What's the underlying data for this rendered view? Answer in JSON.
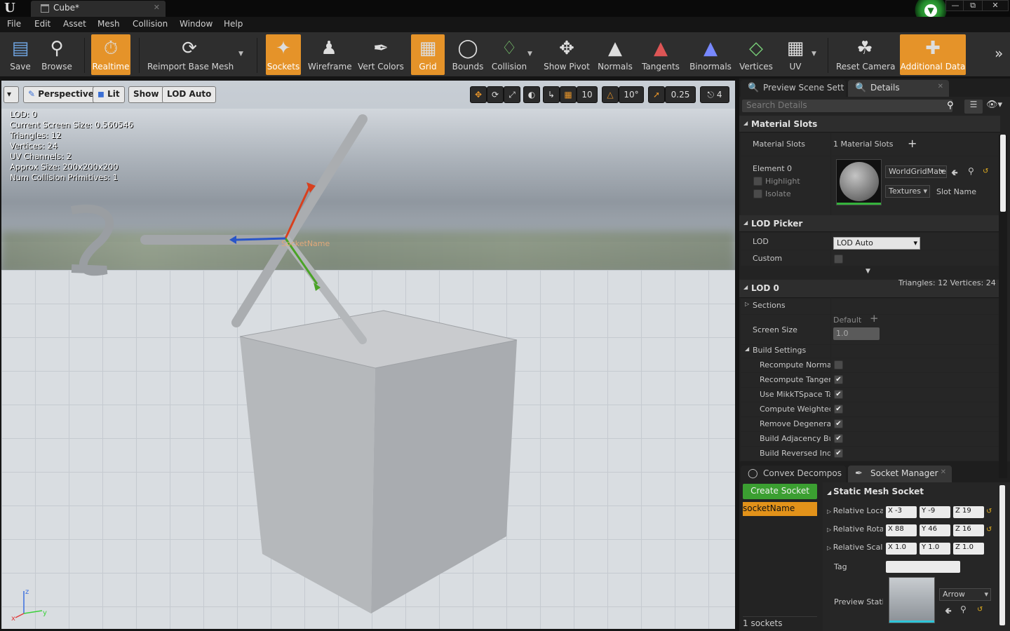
{
  "window": {
    "tab_title": "Cube*",
    "close_glyph": "✕",
    "minimize_glyph": "—",
    "restore_glyph": "⧉",
    "close_btn_glyph": "✕",
    "badge_glyph": "▼"
  },
  "menu": [
    "File",
    "Edit",
    "Asset",
    "Mesh",
    "Collision",
    "Window",
    "Help"
  ],
  "toolbar": {
    "save": "Save",
    "browse": "Browse",
    "realtime": "Realtime",
    "reimport": "Reimport Base Mesh",
    "sockets": "Sockets",
    "wireframe": "Wireframe",
    "vert_colors": "Vert Colors",
    "grid": "Grid",
    "bounds": "Bounds",
    "collision": "Collision",
    "show_pivot": "Show Pivot",
    "normals": "Normals",
    "tangents": "Tangents",
    "binormals": "Binormals",
    "vertices": "Vertices",
    "uv": "UV",
    "reset_camera": "Reset Camera",
    "additional_data": "Additional Data",
    "more": "»"
  },
  "viewport": {
    "menu_arrow": "▾",
    "perspective": "Perspective",
    "lit": "Lit",
    "show": "Show",
    "lod_auto": "LOD Auto",
    "grid_snap": "10",
    "rot_snap": "10°",
    "scale_snap": "0.25",
    "cam_speed": "4",
    "stats": [
      "LOD:  0",
      "Current Screen Size:  0.560546",
      "Triangles:  12",
      "Vertices:  24",
      "UV Channels:  2",
      "Approx Size: 200x200x200",
      "Num Collision Primitives:  1"
    ],
    "socket_label": "SocketName",
    "axis_x": "x",
    "axis_y": "y",
    "axis_z": "z"
  },
  "tabs_top": {
    "preview": "Preview Scene Sett",
    "details": "Details"
  },
  "details": {
    "search_placeholder": "Search Details",
    "material_slots": {
      "header": "Material Slots",
      "label": "Material Slots",
      "count": "1 Material Slots",
      "element": "Element 0",
      "highlight": "Highlight",
      "isolate": "Isolate",
      "material": "WorldGridMate",
      "textures": "Textures",
      "slot_name": "Slot Name"
    },
    "lod_picker": {
      "header": "LOD Picker",
      "lod_label": "LOD",
      "lod_value": "LOD Auto",
      "custom": "Custom"
    },
    "lod0": {
      "header": "LOD 0",
      "tri_info": "Triangles: 12   Vertices: 24",
      "sections": "Sections",
      "screen_size": "Screen Size",
      "default": "Default",
      "screen_value": "1.0",
      "build_settings": "Build Settings",
      "build_items": [
        {
          "label": "Recompute Normals",
          "checked": false
        },
        {
          "label": "Recompute Tangents",
          "checked": true
        },
        {
          "label": "Use MikkTSpace Tangent Space",
          "checked": true
        },
        {
          "label": "Compute Weighted Normals",
          "checked": true
        },
        {
          "label": "Remove Degenerates",
          "checked": true
        },
        {
          "label": "Build Adjacency Buffer",
          "checked": true
        },
        {
          "label": "Build Reversed Index Buffer",
          "checked": true
        }
      ]
    }
  },
  "tabs_bottom": {
    "convex": "Convex Decompos",
    "socket": "Socket Manager"
  },
  "socket_manager": {
    "create": "Create Socket",
    "socket_name": "socketName",
    "count": "1 sockets",
    "header": "Static Mesh Socket",
    "loc_label": "Relative Location",
    "rot_label": "Relative Rotation",
    "scale_label": "Relative Scale",
    "tag_label": "Tag",
    "preview_label": "Preview Static Mesh",
    "preview_mesh": "Arrow",
    "loc": {
      "x": "X  -3",
      "y": "Y  -9",
      "z": "Z  19"
    },
    "rot": {
      "x": "X  88",
      "y": "Y  46",
      "z": "Z  16"
    },
    "scale": {
      "x": "X  1.0",
      "y": "Y  1.0",
      "z": "Z  1.0"
    }
  },
  "colors": {
    "accent_orange": "#e59329",
    "create_green": "#3b9f31"
  }
}
